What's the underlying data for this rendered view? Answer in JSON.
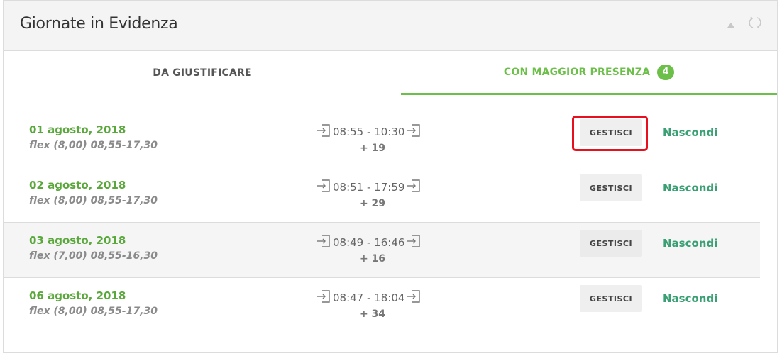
{
  "panel": {
    "title": "Giornate in Evidenza"
  },
  "tabs": [
    {
      "label": "DA GIUSTIFICARE"
    },
    {
      "label": "CON MAGGIOR PRESENZA",
      "badge": "4"
    }
  ],
  "rows": [
    {
      "date": "01 agosto, 2018",
      "schedule": "flex (8,00) 08,55-17,30",
      "times": "08:55 - 10:30",
      "diff": "+ 19",
      "manage_label": "GESTISCI",
      "hide_label": "Nascondi"
    },
    {
      "date": "02 agosto, 2018",
      "schedule": "flex (8,00) 08,55-17,30",
      "times": "08:51 - 17:59",
      "diff": "+ 29",
      "manage_label": "GESTISCI",
      "hide_label": "Nascondi"
    },
    {
      "date": "03 agosto, 2018",
      "schedule": "flex (7,00) 08,55-16,30",
      "times": "08:49 - 16:46",
      "diff": "+ 16",
      "manage_label": "GESTISCI",
      "hide_label": "Nascondi"
    },
    {
      "date": "06 agosto, 2018",
      "schedule": "flex (8,00) 08,55-17,30",
      "times": "08:47 - 18:04",
      "diff": "+ 34",
      "manage_label": "GESTISCI",
      "hide_label": "Nascondi"
    }
  ],
  "icons": {
    "collapse": "caret-up-icon",
    "refresh": "refresh-icon",
    "entry": "sign-in-icon",
    "exit": "sign-in-icon"
  },
  "colors": {
    "accent_green": "#6cc04a",
    "date_green": "#5aa83c",
    "link_green": "#3aa074",
    "highlight_red": "#e8101e"
  }
}
